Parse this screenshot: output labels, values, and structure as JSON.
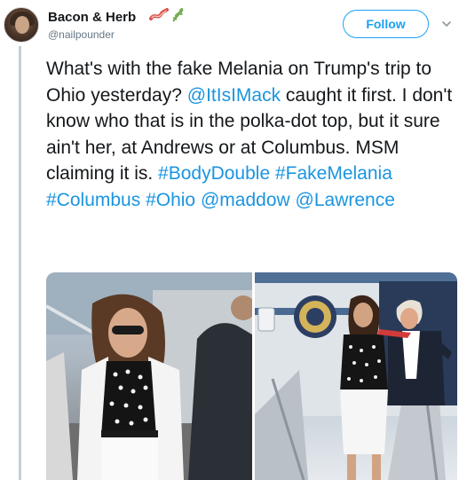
{
  "user": {
    "display_name": "Bacon & Herb",
    "handle": "@nailpounder",
    "emoji": [
      "bacon-icon",
      "herb-icon"
    ]
  },
  "follow_button": {
    "label": "Follow"
  },
  "tweet": {
    "segments": [
      {
        "text": "What's with the fake Melania on Trump's trip to Ohio yesterday? ",
        "link": false
      },
      {
        "text": "@ItIsIMack",
        "link": true
      },
      {
        "text": " caught it first. I don't know who that is in the polka-dot top, but it sure ain't her, at Andrews or at Columbus. MSM claiming it is. ",
        "link": false
      },
      {
        "text": "#BodyDouble",
        "link": true
      },
      {
        "text": " ",
        "link": false
      },
      {
        "text": "#FakeMelania",
        "link": true
      },
      {
        "text": " ",
        "link": false
      },
      {
        "text": "#Columbus",
        "link": true
      },
      {
        "text": " ",
        "link": false
      },
      {
        "text": "#Ohio",
        "link": true
      },
      {
        "text": " ",
        "link": false
      },
      {
        "text": "@maddow",
        "link": true
      },
      {
        "text": " ",
        "link": false
      },
      {
        "text": "@Lawrence",
        "link": true
      }
    ]
  },
  "colors": {
    "link": "#1b95e0",
    "follow": "#1da1f2",
    "text": "#14171a",
    "muted": "#657786"
  }
}
